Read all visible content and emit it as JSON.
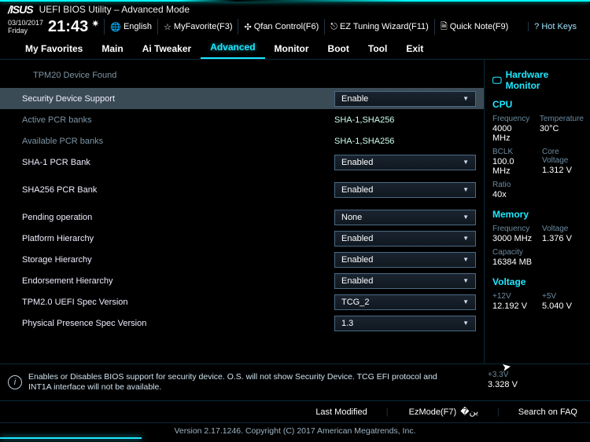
{
  "header": {
    "logo": "/ISUS",
    "title": "UEFI BIOS Utility – Advanced Mode"
  },
  "info": {
    "date": "03/10/2017",
    "day": "Friday",
    "clock": "21:43",
    "lang": "English",
    "btns": [
      {
        "icon": "☆",
        "label": "MyFavorite(F3)"
      },
      {
        "icon": "✣",
        "label": "Qfan Control(F6)"
      },
      {
        "icon": "⎋",
        "label": "EZ Tuning Wizard(F11)"
      },
      {
        "icon": "🗎",
        "label": "Quick Note(F9)"
      }
    ],
    "hotkeys": "Hot Keys"
  },
  "tabs": [
    "My Favorites",
    "Main",
    "Ai Tweaker",
    "Advanced",
    "Monitor",
    "Boot",
    "Tool",
    "Exit"
  ],
  "active_tab": "Advanced",
  "notice": "TPM20 Device Found",
  "rows": [
    {
      "label": "Security Device Support",
      "select": "Enable",
      "hl": true
    },
    {
      "label": "Active PCR banks",
      "text": "SHA-1,SHA256",
      "dim": true
    },
    {
      "label": "Available PCR banks",
      "text": "SHA-1,SHA256",
      "dim": true
    },
    {
      "label": "SHA-1 PCR Bank",
      "select": "Enabled"
    },
    {
      "label": "SHA256 PCR Bank",
      "select": "Enabled"
    },
    {
      "label": "Pending operation",
      "select": "None"
    },
    {
      "label": "Platform Hierarchy",
      "select": "Enabled"
    },
    {
      "label": "Storage Hierarchy",
      "select": "Enabled"
    },
    {
      "label": "Endorsement Hierarchy",
      "select": "Enabled"
    },
    {
      "label": "TPM2.0 UEFI Spec Version",
      "select": "TCG_2"
    },
    {
      "label": "Physical Presence Spec Version",
      "select": "1.3"
    }
  ],
  "help_text": "Enables or Disables BIOS support for security device. O.S. will not show Security Device. TCG EFI protocol and INT1A interface will not be available.",
  "hw": {
    "header": "Hardware Monitor",
    "groups": [
      {
        "title": "CPU",
        "pairs": [
          {
            "k1": "Frequency",
            "v1": "4000 MHz",
            "k2": "Temperature",
            "v2": "30°C"
          },
          {
            "k1": "BCLK",
            "v1": "100.0 MHz",
            "k2": "Core Voltage",
            "v2": "1.312 V"
          },
          {
            "k1": "Ratio",
            "v1": "40x"
          }
        ]
      },
      {
        "title": "Memory",
        "pairs": [
          {
            "k1": "Frequency",
            "v1": "3000 MHz",
            "k2": "Voltage",
            "v2": "1.376 V"
          },
          {
            "k1": "Capacity",
            "v1": "16384 MB"
          }
        ]
      },
      {
        "title": "Voltage",
        "pairs": [
          {
            "k1": "+12V",
            "v1": "12.192 V",
            "k2": "+5V",
            "v2": "5.040 V"
          }
        ]
      }
    ],
    "extra": {
      "k": "+3.3V",
      "v": "3.328 V"
    }
  },
  "footer": {
    "last": "Last Modified",
    "ez": "EzMode(F7)",
    "faq": "Search on FAQ",
    "version": "Version 2.17.1246. Copyright (C) 2017 American Megatrends, Inc."
  }
}
